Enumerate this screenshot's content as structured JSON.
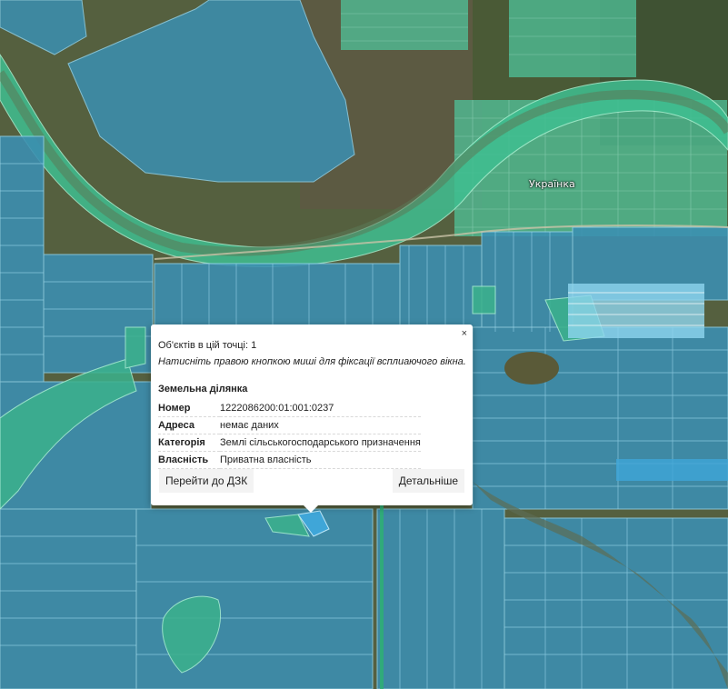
{
  "map": {
    "town_label": "Українка",
    "colors": {
      "parcel_fill": "#3b8fb2",
      "parcel_line": "#8fd0e8",
      "green_zone": "#3bb28c",
      "river_band": "#3fbf91",
      "selected_parcel": "#3fa6d8"
    }
  },
  "popup": {
    "close_label": "×",
    "count_text": "Об'єктів в цій точці: 1",
    "hint_text": "Натисніть правою кнопкою миші для фіксації всплиаючого вікна.",
    "section_title": "Земельна ділянка",
    "attributes": [
      {
        "key": "Номер",
        "value": "1222086200:01:001:0237"
      },
      {
        "key": "Адреса",
        "value": "немає даних"
      },
      {
        "key": "Категорія",
        "value": "Землі сільськогосподарського призначення"
      },
      {
        "key": "Власність",
        "value": "Приватна власність"
      }
    ],
    "btn_dzk": "Перейти до ДЗК",
    "btn_more": "Детальніше"
  }
}
